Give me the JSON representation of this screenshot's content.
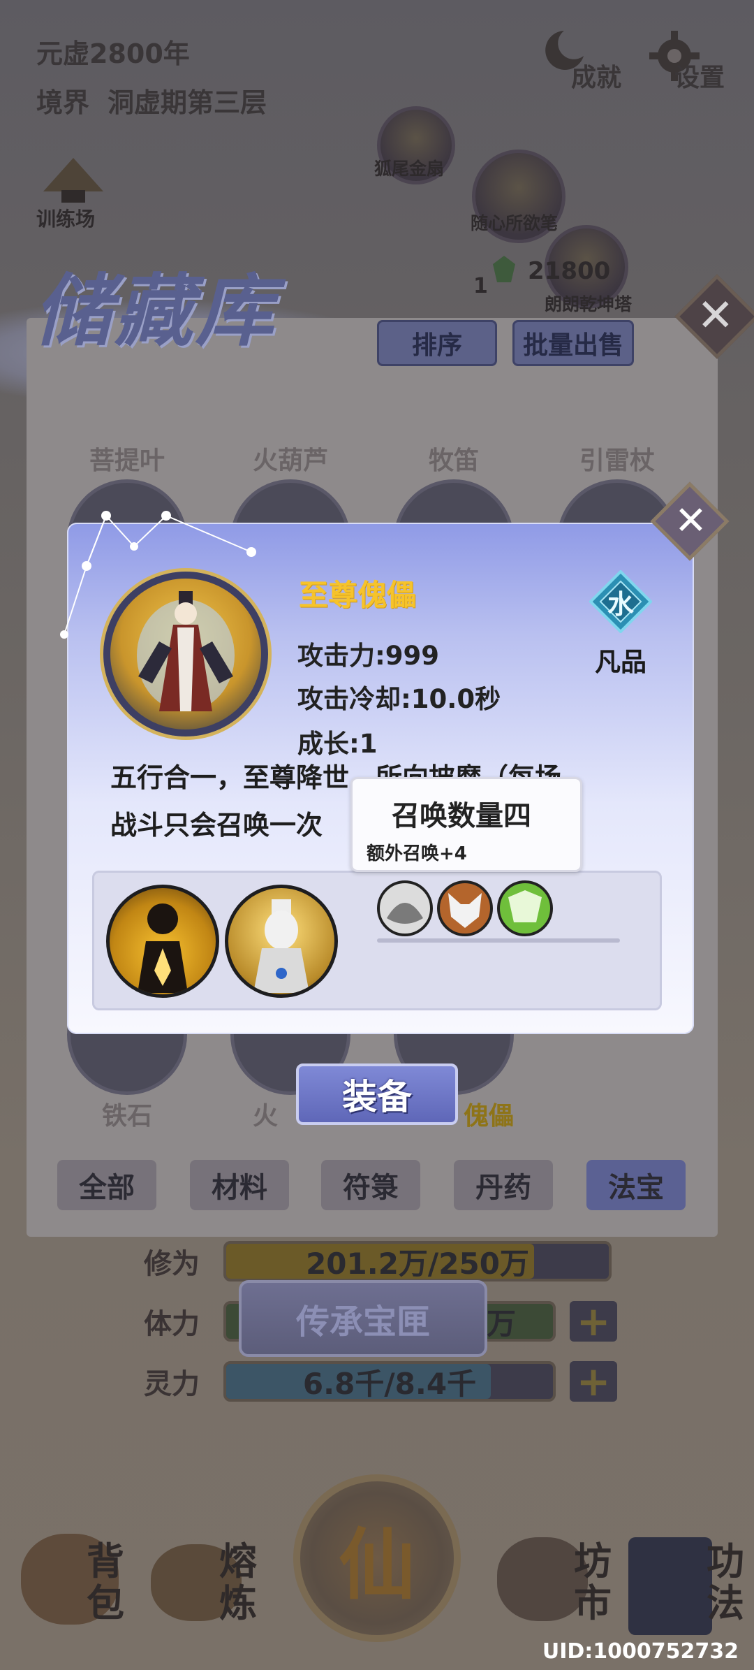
{
  "hud": {
    "year": "元虚2800年",
    "realm_label": "境界",
    "realm_value": "洞虚期第三层",
    "achievements": "成就",
    "settings": "设置"
  },
  "map": {
    "training": "训练场",
    "fox_fan": "狐尾金扇",
    "brush": "随心所欲笔",
    "tower": "朗朗乾坤塔",
    "count": "1",
    "spirit_stones": "21800"
  },
  "storage": {
    "title": "储藏库",
    "sort_button": "排序",
    "bulk_sell_button": "批量出售",
    "row1": [
      "菩提叶",
      "火葫芦",
      "牧笛",
      "引雷杖"
    ],
    "row_bottom": [
      "铁石",
      "火",
      "",
      "傀儡"
    ],
    "tabs": [
      "全部",
      "材料",
      "符箓",
      "丹药",
      "法宝"
    ],
    "active_tab": "法宝",
    "equip_button": "装备"
  },
  "detail": {
    "name": "至尊傀儡",
    "attack": "攻击力:999",
    "cooldown": "攻击冷却:10.0秒",
    "growth": "成长:1",
    "grade_glyph": "水",
    "grade": "凡品",
    "desc_line1": "五行合一，至尊降世，所向披靡（每场",
    "desc_line2": "战斗只会召唤一次",
    "tooltip_title": "召唤数量四",
    "tooltip_sub": "额外召唤+4"
  },
  "stats": {
    "cultivation_label": "修为",
    "cultivation_value": "201.2万/250万",
    "cultivation_progress": 0.805,
    "stamina_label": "体力",
    "stamina_value": "万",
    "spirit_label": "灵力",
    "spirit_value": "6.8千/8.4千",
    "spirit_progress": 0.81,
    "plus": "+"
  },
  "inherit_button": "传承宝匣",
  "nav": {
    "bag": [
      "背",
      "包"
    ],
    "smelt": [
      "熔",
      "炼"
    ],
    "center": "仙",
    "market": [
      "坊",
      "市"
    ],
    "skills": [
      "功",
      "法"
    ]
  },
  "uid": "UID:1000752732",
  "colors": {
    "accent": "#5f67b8",
    "name_gold": "#f6c32b",
    "popup_top": "#8f9ae6"
  }
}
